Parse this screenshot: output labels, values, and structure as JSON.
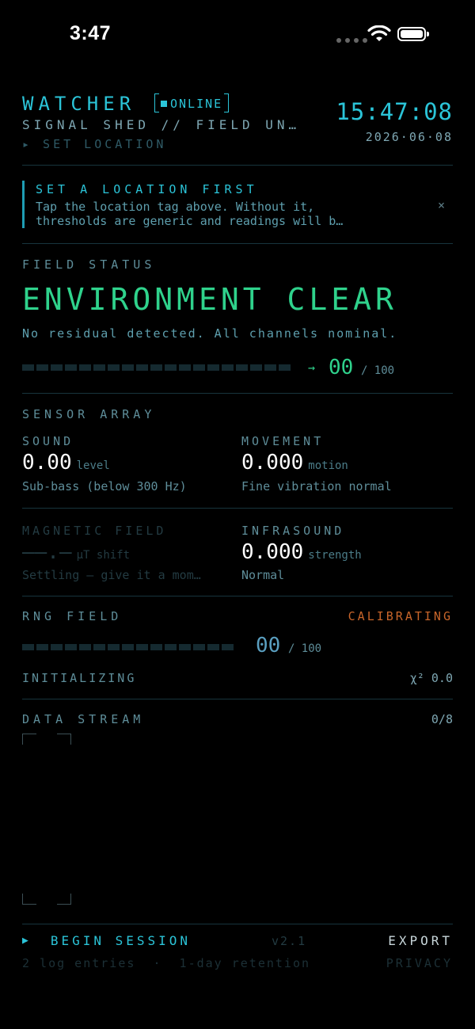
{
  "statusbar": {
    "time": "3:47"
  },
  "header": {
    "brand": "WATCHER",
    "online": "ONLINE",
    "subtitle": "SIGNAL SHED  //  FIELD UN…",
    "set_location": "▸ SET LOCATION",
    "clock": "15:47:08",
    "date": "2026·06·08"
  },
  "banner": {
    "title": "SET A LOCATION FIRST",
    "line1": "Tap the location tag above. Without it,",
    "line2": "thresholds are generic and readings will b…",
    "close": "×"
  },
  "field_status": {
    "label": "FIELD STATUS",
    "status": "ENVIRONMENT CLEAR",
    "description": "No residual detected. All channels nominal.",
    "arrow": "→",
    "score": "00",
    "score_max": "/ 100",
    "level": 0
  },
  "sensor_array": {
    "label": "SENSOR ARRAY",
    "sound": {
      "name": "SOUND",
      "value": "0.00",
      "unit": "level",
      "note": "Sub-bass (below 300 Hz)"
    },
    "movement": {
      "name": "MOVEMENT",
      "value": "0.000",
      "unit": "motion",
      "note": "Fine vibration normal"
    },
    "magnetic": {
      "name": "MAGNETIC FIELD",
      "value": "——.—",
      "unit": "μT shift",
      "note": "Settling — give it a mom…"
    },
    "infrasound": {
      "name": "INFRASOUND",
      "value": "0.000",
      "unit": "strength",
      "note": "Normal"
    }
  },
  "rng": {
    "label": "RNG FIELD",
    "state": "CALIBRATING",
    "score": "00",
    "score_max": "/ 100",
    "level": 0,
    "status": "INITIALIZING",
    "chi": "χ² 0.0"
  },
  "data_stream": {
    "label": "DATA STREAM",
    "count": "0/8"
  },
  "footer": {
    "begin_icon": "▶",
    "begin": "BEGIN SESSION",
    "version": "v2.1",
    "export": "EXPORT",
    "log": "2 log entries  ·  1-day retention",
    "privacy": "PRIVACY"
  },
  "colors": {
    "accent": "#2bc4d8",
    "clear": "#2fd28c",
    "warn": "#c8652a"
  },
  "icons": [
    "wifi-icon",
    "battery-icon",
    "close-icon",
    "arrow-right-icon",
    "play-icon"
  ]
}
